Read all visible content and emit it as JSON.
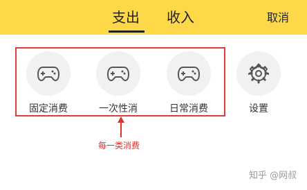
{
  "header": {
    "tabs": [
      {
        "label": "支出",
        "active": true
      },
      {
        "label": "收入",
        "active": false
      }
    ],
    "cancel_label": "取消",
    "background_color": "#fdd94a"
  },
  "categories": [
    {
      "label": "固定消费",
      "icon": "gamepad-icon"
    },
    {
      "label": "一次性消",
      "icon": "gamepad-icon"
    },
    {
      "label": "日常消费",
      "icon": "gamepad-icon"
    },
    {
      "label": "设置",
      "icon": "gear-icon"
    }
  ],
  "annotation": {
    "text": "每一类消费",
    "color": "#d8342f"
  },
  "watermark": "知乎 @网叔"
}
